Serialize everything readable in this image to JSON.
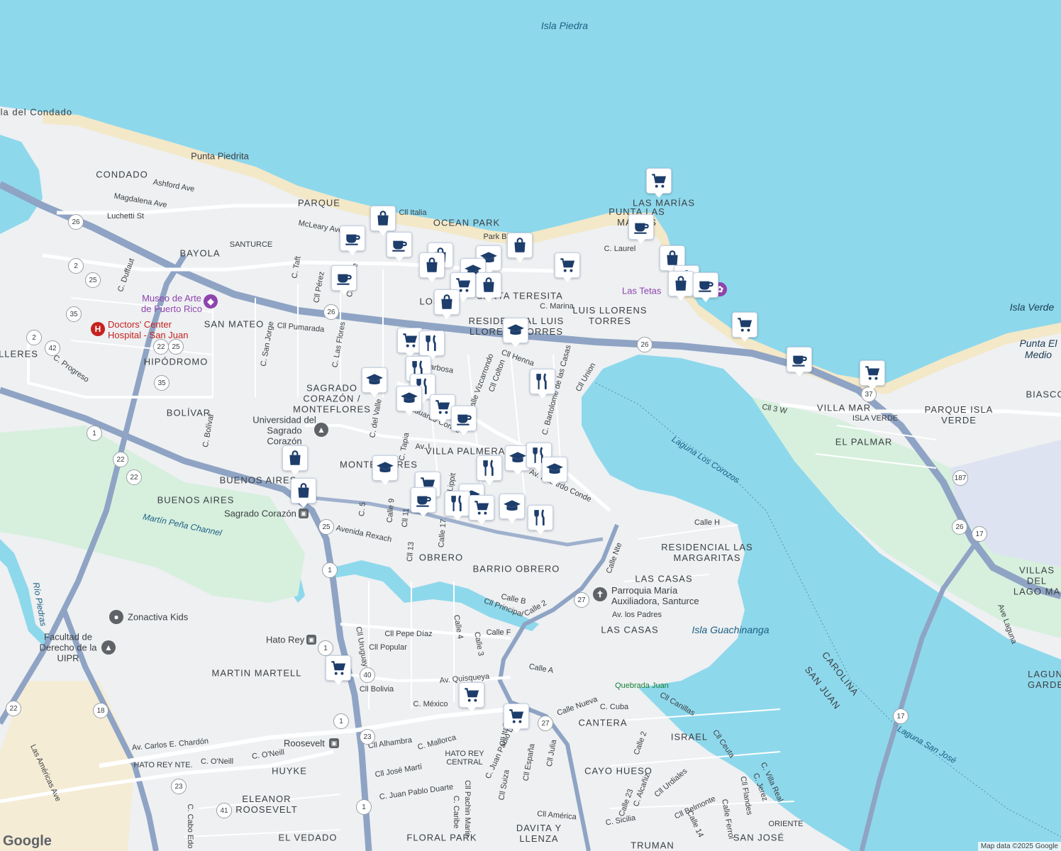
{
  "map": {
    "water": [
      {
        "label": "Isla Piedra",
        "kind": "water"
      },
      {
        "label": "Laguna Los Corozos",
        "kind": "lagoon"
      },
      {
        "label": "Martín Peña Channel",
        "kind": "channel"
      },
      {
        "label": "Río Piedras",
        "kind": "river"
      },
      {
        "label": "Laguna San José",
        "kind": "lagoon"
      },
      {
        "label": "Isla Guachinanga",
        "kind": "island"
      },
      {
        "label": "Quebrada Juan",
        "kind": "creek"
      }
    ],
    "neighborhoods": [
      "Península del Condado",
      "CONDADO",
      "Punta Piedrita",
      "PARQUE",
      "OCEAN PARK",
      "BAYOLA",
      "SAN MATEO",
      "HIPÓDROMO",
      "LLERES",
      "BOLÍVAR",
      "SAGRADO CORAZÓN / MONTEFLORES",
      "SANTA TERESITA",
      "LUIS LLORENS TORRES",
      "RESIDENCIAL LUIS LLORENS TORRES",
      "LAS MARÍAS",
      "PUNTA LAS MARÍAS",
      "VILLA PALMERAS",
      "MONTEFLORES",
      "BUENOS AIRES",
      "OBRERO",
      "BARRIO OBRERO",
      "RESIDENCIAL LAS MARGARITAS",
      "LAS CASAS",
      "MARTIN MARTELL",
      "HUYKE",
      "ELEANOR ROOSEVELT",
      "EL VEDADO",
      "FLORAL PARK",
      "DAVITA Y LLENZA",
      "TRUMAN",
      "CANTERA",
      "ISRAEL",
      "CAYO HUESO",
      "SAN JOSÉ",
      "ORIENTE",
      "VILLA MAR",
      "EL PALMAR",
      "PARQUE ISLA VERDE",
      "ISLA VERDE",
      "Isla Verde",
      "Punta El Medio",
      "BIASCO",
      "VILLAS DEL LAGO MA",
      "LAGUN GARDE",
      "CAROLINA",
      "SAN JUAN",
      "HATO REY CENTRAL",
      "HATO REY NTE.",
      "SANTURCE",
      "LOS",
      "Las Tetas"
    ],
    "streets": [
      "Ashford Ave",
      "Magdalena Ave",
      "Luchetti St",
      "McLeary Ave",
      "Cll Italia",
      "Park Blvd",
      "C. Laurel",
      "C. Marina",
      "Cll Pumarada",
      "C. Duffaut",
      "C. Progreso",
      "C. Taft",
      "Cll Pérez",
      "C. Aponte",
      "C. San Jorge",
      "C. Las Flores",
      "Cll Henna",
      "Cll Colton",
      "Calle Vizcarrondo",
      "Av. Eduardo Conde",
      "Av. Barbosa",
      "Cll Union",
      "C. Bartolomé de las Casas",
      "C. del Valle",
      "C. Tapia",
      "Av. I",
      "Lippit",
      "Calle 9",
      "Cll 11",
      "Cll 13",
      "Calle 17",
      "C. 5",
      "Avenida Rexach",
      "Calle Nte",
      "Calle H",
      "Cll 3 W",
      "Calle B",
      "Cll Principal",
      "Calle 2",
      "Av. los Padres",
      "Cll Pepe Díaz",
      "Cll Popular",
      "Cll Uruguay",
      "Calle 4",
      "Calle 3",
      "Calle F",
      "Calle A",
      "Av. Quisqueya",
      "Cll Bolivia",
      "C. México",
      "Calle Nueva",
      "C. Cuba",
      "Cll Canillas",
      "Cll Ceuta",
      "Av. Carlos E. Chardón",
      "Cll Alhambra",
      "C. Mallorca",
      "C. O'Neill",
      "Cll José Martí",
      "C. Juan Pablo Duarte",
      "Cll Suiza",
      "Cll Italia",
      "Cll España",
      "Cll Julia",
      "Cll Pachin Marin",
      "C. Caribe",
      "Cll América",
      "C. Sicilia",
      "C. Alcañiz",
      "Cll Urdiales",
      "Cll Belmonte",
      "Calle 14",
      "Calle Ferrol",
      "Cll Flandes",
      "C. Jerez",
      "C. Villa Real",
      "C. Bolívar",
      "Las Américas Ave",
      "C. Cabo Edo",
      "Calle 23",
      "Calle 2",
      "Ave Laguna"
    ],
    "pois": [
      {
        "label": "Museo de Arte de Puerto Rico",
        "type": "museum"
      },
      {
        "label": "Doctors' Center Hospital - San Juan",
        "type": "hospital"
      },
      {
        "label": "Universidad del Sagrado Corazón",
        "type": "university"
      },
      {
        "label": "Sagrado Corazón",
        "type": "transit"
      },
      {
        "label": "Hato Rey",
        "type": "transit"
      },
      {
        "label": "Roosevelt",
        "type": "transit"
      },
      {
        "label": "Zonactiva Kids",
        "type": "place"
      },
      {
        "label": "Facultad de Derecho de la UIPR",
        "type": "university"
      },
      {
        "label": "Parroquia María Auxiliadora, Santurce",
        "type": "church"
      },
      {
        "label": "Las Tetas",
        "type": "landmark"
      }
    ],
    "highways": [
      "26",
      "2",
      "25",
      "35",
      "22",
      "42",
      "1",
      "37",
      "187",
      "17",
      "27",
      "40",
      "23",
      "18",
      "41"
    ],
    "attribution": "Map data ©2025 Google",
    "logo": "Google",
    "colors": {
      "water": "#8ed8ec",
      "land": "#eef0f2",
      "park": "#c9ecd4",
      "highway": "#8fa4c4",
      "pin_icon": "#1d3d6b"
    }
  }
}
